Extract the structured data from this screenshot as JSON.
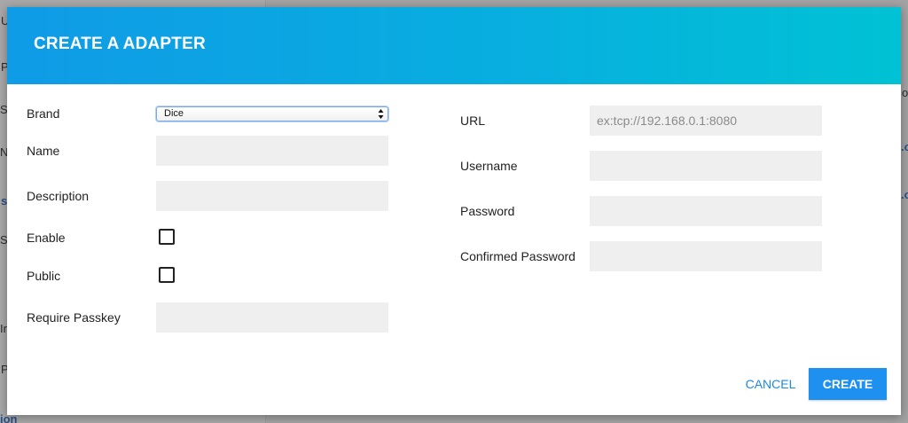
{
  "dialog": {
    "title": "CREATE A ADAPTER"
  },
  "form_left": {
    "brand_label": "Brand",
    "brand_selected": "Dice",
    "name_label": "Name",
    "description_label": "Description",
    "enable_label": "Enable",
    "public_label": "Public",
    "require_passkey_label": "Require Passkey"
  },
  "form_right": {
    "url_label": "URL",
    "url_placeholder": "ex:tcp://192.168.0.1:8080",
    "username_label": "Username",
    "password_label": "Password",
    "confirmed_password_label": "Confirmed Password"
  },
  "actions": {
    "cancel_label": "CANCEL",
    "create_label": "CREATE"
  },
  "background": {
    "fragments": [
      "U",
      "P",
      "S",
      "N",
      "s",
      "S",
      "Ir",
      "P",
      "ion",
      "o",
      ".o",
      ".o"
    ]
  },
  "colors": {
    "header_start": "#0f9be6",
    "header_end": "#00c2d4",
    "primary": "#1e90f0"
  }
}
